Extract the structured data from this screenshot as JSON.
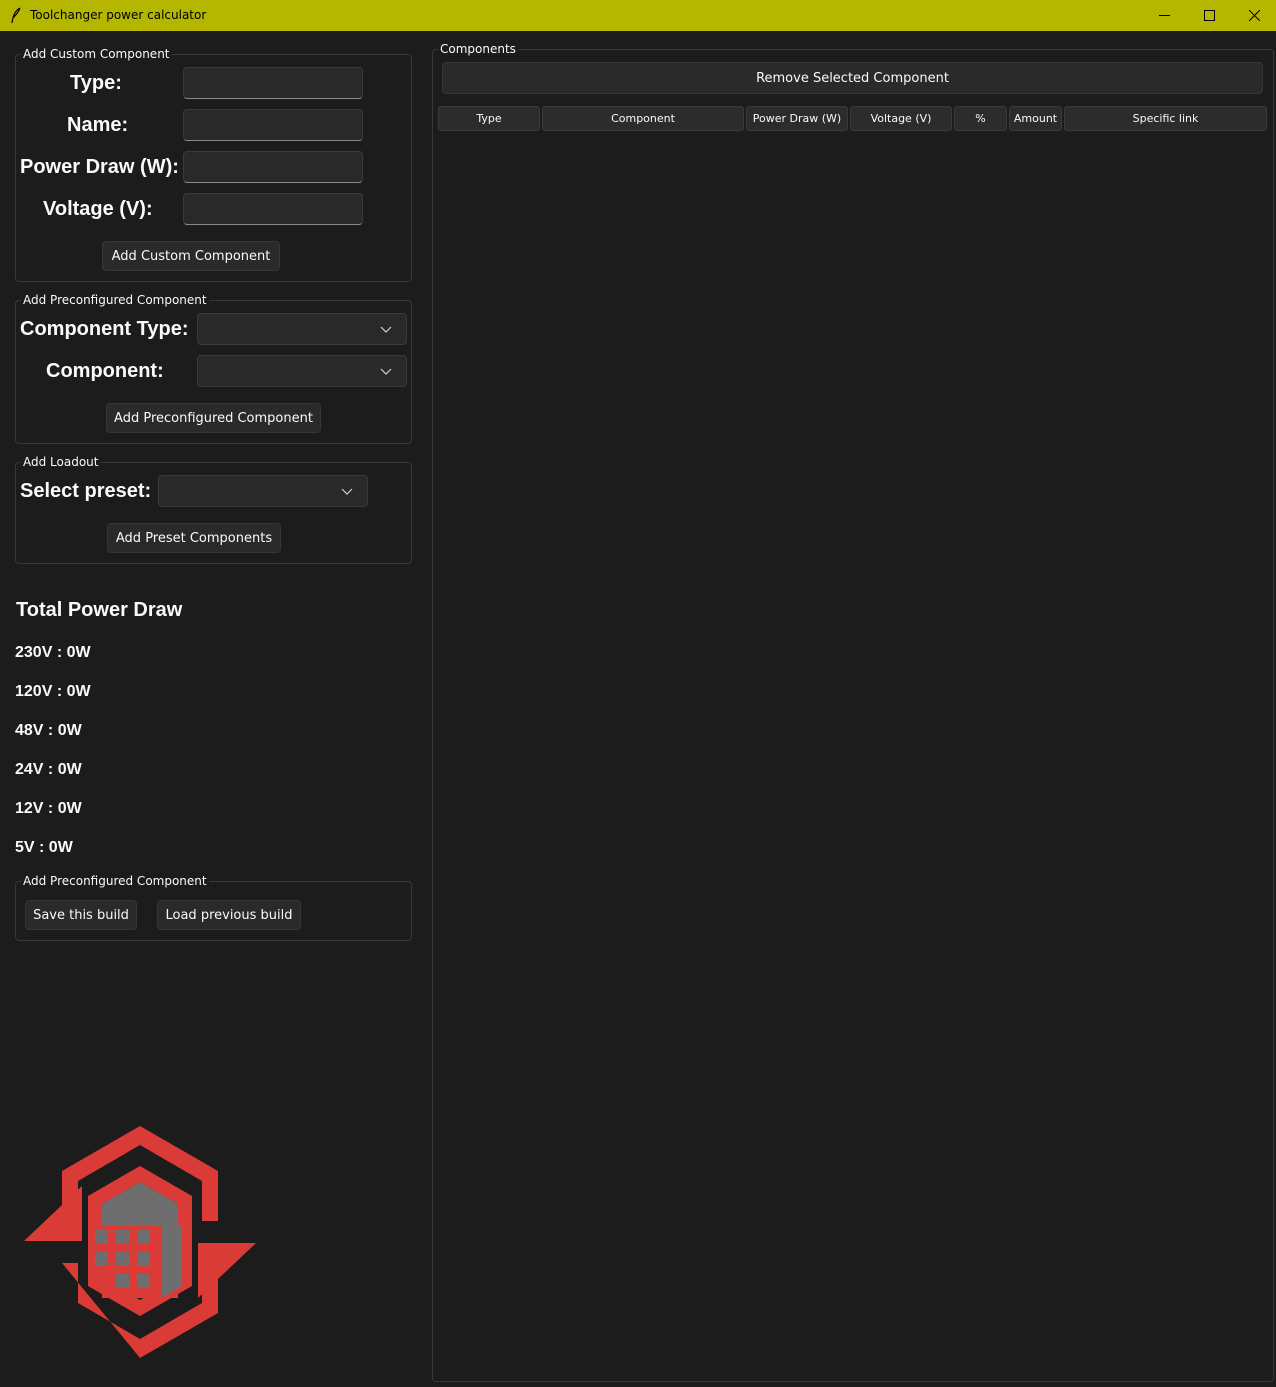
{
  "window": {
    "title": "Toolchanger power calculator"
  },
  "custom_component": {
    "group_label": "Add Custom Component",
    "type_label": "Type:",
    "name_label": "Name:",
    "power_label": "Power Draw (W):",
    "voltage_label": "Voltage (V):",
    "add_button": "Add Custom Component"
  },
  "preconfigured_component": {
    "group_label": "Add Preconfigured Component",
    "type_label": "Component Type:",
    "component_label": "Component:",
    "add_button": "Add Preconfigured Component"
  },
  "loadout": {
    "group_label": "Add Loadout",
    "preset_label": "Select preset:",
    "add_button": "Add Preset Components"
  },
  "power": {
    "title": "Total Power Draw",
    "lines": [
      "230V : 0W",
      "120V : 0W",
      "48V : 0W",
      "24V : 0W",
      "12V : 0W",
      "5V : 0W"
    ]
  },
  "build": {
    "group_label": "Add Preconfigured Component",
    "save_button": "Save this build",
    "load_button": "Load previous build"
  },
  "components": {
    "group_label": "Components",
    "remove_button": "Remove Selected Component",
    "columns": [
      "Type",
      "Component",
      "Power Draw (W)",
      "Voltage (V)",
      "%",
      "Amount",
      "Specific link"
    ]
  },
  "colors": {
    "titlebar": "#b5b600",
    "background": "#1c1c1c",
    "logo_red": "#db3b36",
    "logo_gray": "#6e6e6e"
  },
  "icons": {
    "app": "feather-icon",
    "minimize": "minimize-icon",
    "maximize": "maximize-icon",
    "close": "close-icon",
    "dropdown": "chevron-down-icon"
  }
}
